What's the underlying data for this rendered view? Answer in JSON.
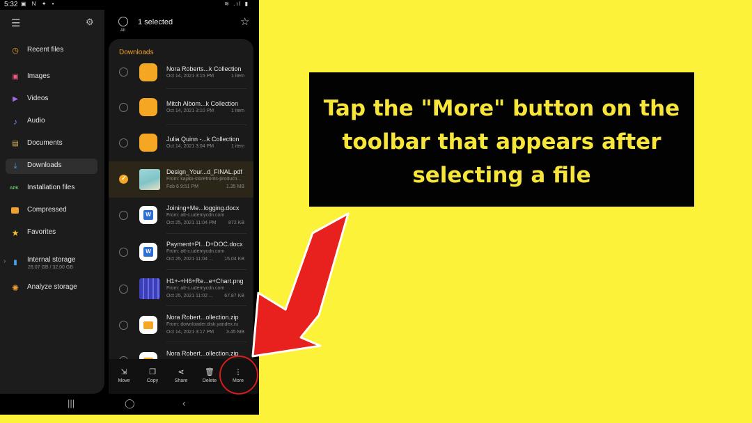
{
  "status_bar": {
    "time": "5:32",
    "left_icons": "▣ N ✦ •",
    "right_icons": "≋ .ıl ▮"
  },
  "drawer": {
    "items": [
      {
        "label": "Recent files",
        "icon": "clock-icon",
        "color": "#f0a030"
      },
      {
        "label": "Images",
        "icon": "image-icon",
        "color": "#ec5b7d"
      },
      {
        "label": "Videos",
        "icon": "video-icon",
        "color": "#a768e8"
      },
      {
        "label": "Audio",
        "icon": "music-note-icon",
        "color": "#5f8cf0"
      },
      {
        "label": "Documents",
        "icon": "document-icon",
        "color": "#e8c06a"
      },
      {
        "label": "Downloads",
        "icon": "download-icon",
        "color": "#4aa0e8"
      },
      {
        "label": "Installation files",
        "icon": "apk-icon",
        "color": "#6bc46b"
      },
      {
        "label": "Compressed",
        "icon": "folder-zip-icon",
        "color": "#f0a030"
      },
      {
        "label": "Favorites",
        "icon": "star-icon",
        "color": "#f5c02a"
      }
    ],
    "storage": {
      "label": "Internal storage",
      "usage": "28.07 GB / 32.00 GB"
    },
    "analyze": {
      "label": "Analyze storage"
    }
  },
  "selection_bar": {
    "all_label": "All",
    "selected_text": "1 selected"
  },
  "list": {
    "section_title": "Downloads",
    "rows": [
      {
        "name": "Nora Roberts...k Collection",
        "date": "Oct 14, 2021 3:15 PM",
        "size": "1 item",
        "type": "folder",
        "selected": false
      },
      {
        "name": "Mitch Albom...k Collection",
        "date": "Oct 14, 2021 3:10 PM",
        "size": "1 item",
        "type": "folder",
        "selected": false
      },
      {
        "name": "Julia Quinn -...k Collection",
        "date": "Oct 14, 2021 3:04 PM",
        "size": "1 item",
        "type": "folder",
        "selected": false
      },
      {
        "name": "Design_Your...d_FINAL.pdf",
        "source": "From: kajabi-storefronts-producti...",
        "date": "Feb 6 9:51 PM",
        "size": "1.35 MB",
        "type": "pdf",
        "selected": true
      },
      {
        "name": "Joining+Me...logging.docx",
        "source": "From: att-c.udemycdn.com",
        "date": "Oct 25, 2021 11:04 PM",
        "size": "872 KB",
        "type": "docx",
        "selected": false
      },
      {
        "name": "Payment+Pl...D+DOC.docx",
        "source": "From: att-c.udemycdn.com",
        "date": "Oct 25, 2021 11:04 ...",
        "size": "15.04 KB",
        "type": "docx",
        "selected": false
      },
      {
        "name": "H1+-+H6+Re...e+Chart.png",
        "source": "From: att-c.udemycdn.com",
        "date": "Oct 25, 2021 11:02 ...",
        "size": "67.87 KB",
        "type": "png",
        "selected": false
      },
      {
        "name": "Nora Robert...ollection.zip",
        "source": "From: downloader.disk.yandex.ru",
        "date": "Oct 14, 2021 3:17 PM",
        "size": "3.45 MB",
        "type": "zip",
        "selected": false
      },
      {
        "name": "Nora Robert...ollection.zip",
        "type": "zip",
        "selected": false
      }
    ]
  },
  "toolbar": {
    "move": "Move",
    "copy": "Copy",
    "share": "Share",
    "delete": "Delete",
    "more": "More"
  },
  "callout": {
    "lines": [
      "Tap the \"More\" button on the",
      "toolbar that appears after",
      "selecting a file"
    ]
  },
  "colors": {
    "background": "#fdf23a",
    "callout_text": "#f7e53a",
    "accent_orange": "#f5a623",
    "arrow_red": "#e8201e"
  }
}
